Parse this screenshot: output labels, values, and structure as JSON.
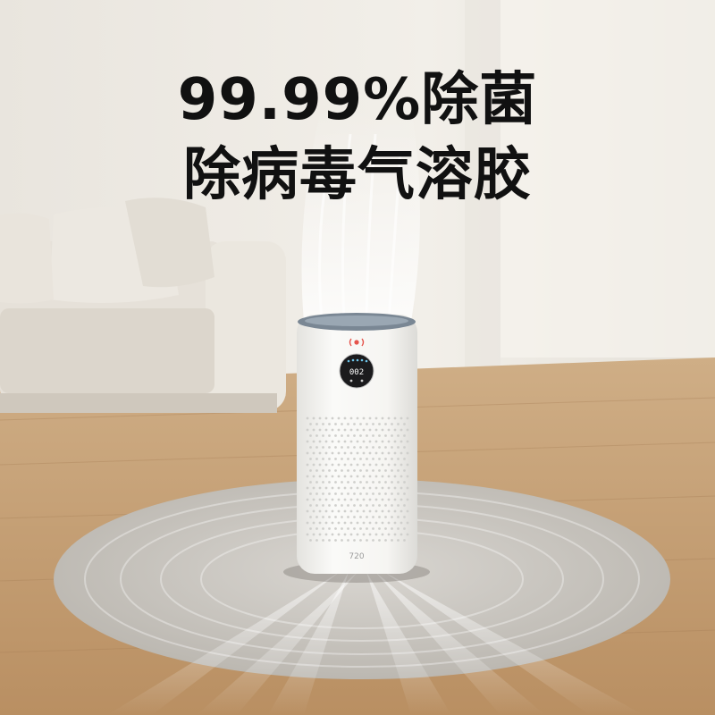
{
  "headline": {
    "line1": "99.99%除菌",
    "line2": "除病毒气溶胶"
  },
  "product": {
    "brand_mark": "720",
    "display_reading": "002",
    "name": "air-purifier"
  },
  "colors": {
    "wall": "#efece6",
    "floor": "#c9a47a",
    "purifier_body": "#f5f5f3",
    "display_bg": "#1b1b1d",
    "indicator_red": "#e5534b",
    "headline_text": "#111111"
  }
}
